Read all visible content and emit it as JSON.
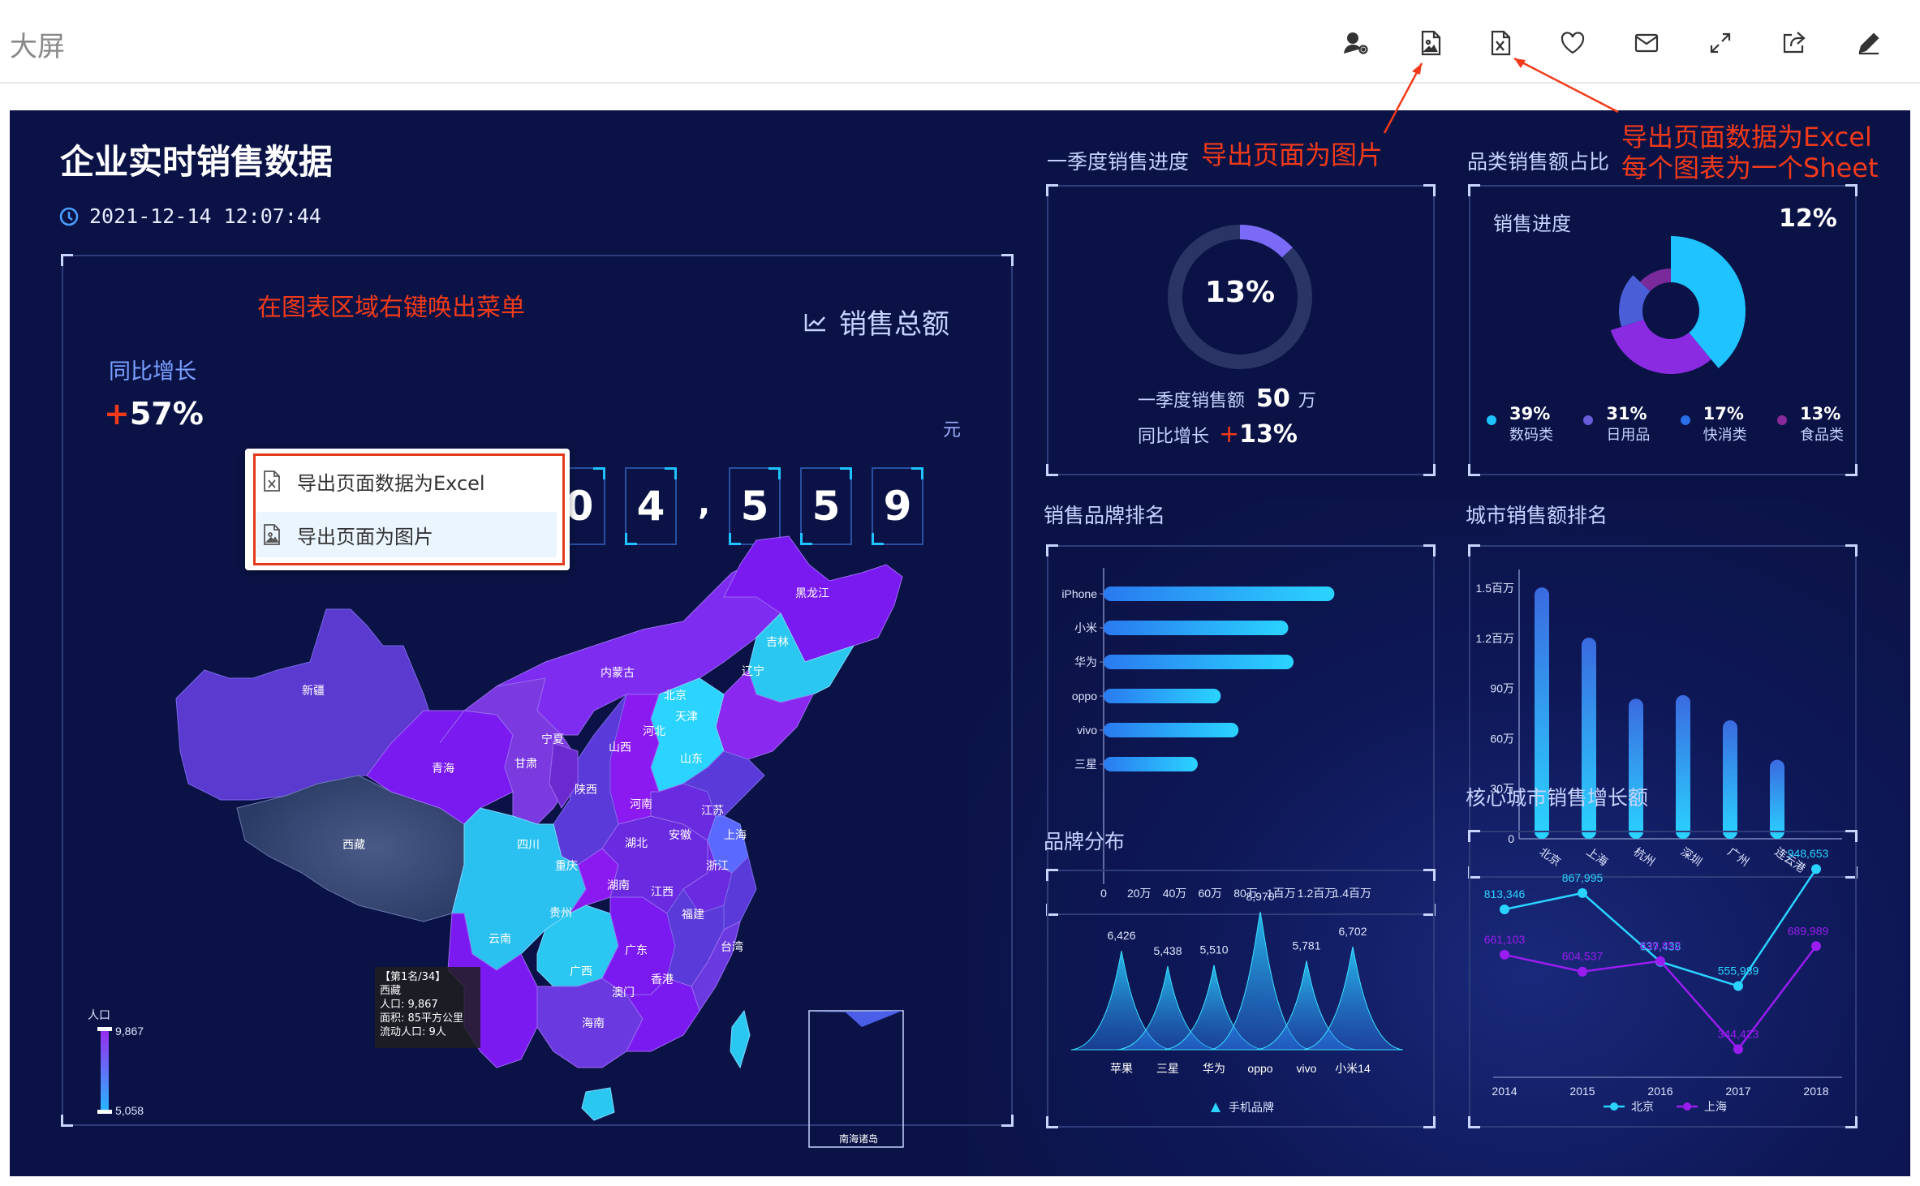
{
  "topbar": {
    "title": "大屏",
    "icons": [
      "user-settings-icon",
      "export-image-icon",
      "export-excel-icon",
      "heart-icon",
      "mail-icon",
      "fullscreen-icon",
      "share-icon",
      "edit-icon"
    ]
  },
  "dashboard": {
    "title": "企业实时销售数据",
    "datetime": "2021-12-14 12:07:44",
    "total_sales_label": "销售总额",
    "yoy_label": "同比增长",
    "yoy_sign": "+",
    "yoy_value": "57%",
    "digits": [
      "0",
      "4",
      ",",
      "5",
      "5",
      "9"
    ],
    "unit": "元"
  },
  "annotations": {
    "context_menu_hint": "在图表区域右键唤出菜单",
    "export_image_hint": "导出页面为图片",
    "export_excel_hint_line1": "导出页面数据为Excel",
    "export_excel_hint_line2": "每个图表为一个Sheet"
  },
  "context_menu": {
    "items": [
      {
        "label": "导出页面数据为Excel",
        "icon": "excel-file-icon"
      },
      {
        "label": "导出页面为图片",
        "icon": "image-file-icon"
      }
    ]
  },
  "map": {
    "provinces": [
      "新疆",
      "西藏",
      "青海",
      "甘肃",
      "宁夏",
      "内蒙古",
      "黑龙江",
      "吉林",
      "辽宁",
      "北京",
      "天津",
      "河北",
      "山西",
      "陕西",
      "四川",
      "重庆",
      "云南",
      "贵州",
      "广西",
      "广东",
      "湖南",
      "湖北",
      "河南",
      "山东",
      "江苏",
      "安徽",
      "上海",
      "浙江",
      "江西",
      "福建",
      "台湾",
      "香港",
      "澳门",
      "海南"
    ],
    "tooltip": [
      "【第1名/34】",
      "西藏",
      "人口: 9,867",
      "面积: 85平方公里",
      "流动人口: 9人"
    ],
    "legend_title": "人口",
    "legend_max": "9,867",
    "legend_min": "5,058",
    "inset_label": "南海诸岛"
  },
  "q1_progress": {
    "title": "一季度销售进度",
    "percent_label": "13%",
    "percent": 13,
    "sales_label": "一季度销售额",
    "sales_value": "50",
    "sales_unit": "万",
    "yoy_label": "同比增长",
    "yoy_sign": "+",
    "yoy_value": "13%"
  },
  "category_share": {
    "title": "品类销售额占比",
    "sub_label": "销售进度",
    "progress": "12%",
    "colors": [
      "#1fc3ff",
      "#8a2be2",
      "#4a5ed8",
      "#7a2a9a"
    ],
    "items": [
      {
        "pct": "39%",
        "name": "数码类",
        "color": "#1fc3ff"
      },
      {
        "pct": "31%",
        "name": "日用品",
        "color": "#6a5bd8"
      },
      {
        "pct": "17%",
        "name": "快消类",
        "color": "#2a6ee8"
      },
      {
        "pct": "13%",
        "name": "食品类",
        "color": "#8a2a9a"
      }
    ]
  },
  "brand_rank": {
    "title": "销售品牌排名",
    "chart_data": {
      "type": "bar",
      "orientation": "horizontal",
      "categories": [
        "iPhone",
        "小米",
        "华为",
        "oppo",
        "vivo",
        "三星"
      ],
      "values": [
        1300000,
        1040000,
        1070000,
        660000,
        760000,
        530000
      ],
      "x_tick_labels": [
        "0",
        "20万",
        "40万",
        "60万",
        "80万",
        "1百万",
        "1.2百万",
        "1.4百万"
      ],
      "xlim": [
        0,
        1600000
      ]
    }
  },
  "city_rank": {
    "title": "城市销售额排名",
    "chart_data": {
      "type": "bar",
      "categories": [
        "北京",
        "上海",
        "杭州",
        "深圳",
        "广州",
        "连云港"
      ],
      "values": [
        1400000,
        1120000,
        780000,
        800000,
        660000,
        440000
      ],
      "y_tick_labels": [
        "0",
        "30万",
        "60万",
        "90万",
        "1.2百万",
        "1.5百万"
      ],
      "ylim": [
        0,
        1500000
      ]
    }
  },
  "brand_dist": {
    "title": "品牌分布",
    "legend": "手机品牌",
    "chart_data": {
      "type": "area",
      "categories": [
        "苹果",
        "三星",
        "华为",
        "oppo",
        "vivo",
        "小米14"
      ],
      "values": [
        6426,
        5438,
        5510,
        8970,
        5781,
        6702
      ],
      "value_labels": [
        "6,426",
        "5,438",
        "5,510",
        "8,970",
        "5,781",
        "6,702"
      ]
    }
  },
  "city_growth": {
    "title": "核心城市销售增长额",
    "chart_data": {
      "type": "line",
      "x": [
        "2014",
        "2015",
        "2016",
        "2017",
        "2018"
      ],
      "series": [
        {
          "name": "北京",
          "color": "#2ad4ff",
          "values": [
            813346,
            867995,
            637438,
            555989,
            948653
          ],
          "labels": [
            "813,346",
            "867,995",
            "637,438",
            "555,989",
            "948,653"
          ]
        },
        {
          "name": "上海",
          "color": "#9a1df0",
          "values": [
            661103,
            604537,
            639852,
            344423,
            689989
          ],
          "labels": [
            "661,103",
            "604,537",
            "639,852",
            "344,423",
            "689,989"
          ]
        }
      ],
      "ylim": [
        250000,
        1050000
      ]
    }
  }
}
